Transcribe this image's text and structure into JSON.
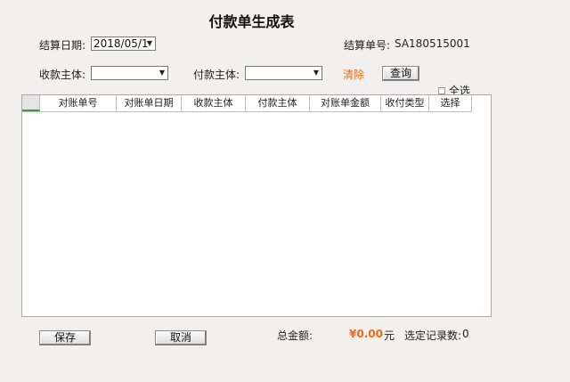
{
  "page": {
    "title": "付款单生成表"
  },
  "form": {
    "date_label": "结算日期:",
    "date_value": "2018/05/1",
    "bill_no_label": "结算单号:",
    "bill_no_value": "SA180515001",
    "receiver_label": "收款主体:",
    "receiver_value": "",
    "payer_label": "付款主体:",
    "payer_value": "",
    "clear_label": "清除",
    "query_label": "查询",
    "select_all_label": "全选"
  },
  "grid": {
    "columns": [
      "对账单号",
      "对账单日期",
      "收款主体",
      "付款主体",
      "对账单金额",
      "收付类型",
      "选择"
    ],
    "rows": []
  },
  "footer": {
    "save_label": "保存",
    "cancel_label": "取消",
    "total_label": "总金额:",
    "total_value": "¥0.00",
    "currency_unit": "元",
    "selected_label": "选定记录数:",
    "selected_count": "0"
  },
  "colors": {
    "accent_orange": "#ee6a1a",
    "grid_corner_green": "#3a9d3a"
  }
}
